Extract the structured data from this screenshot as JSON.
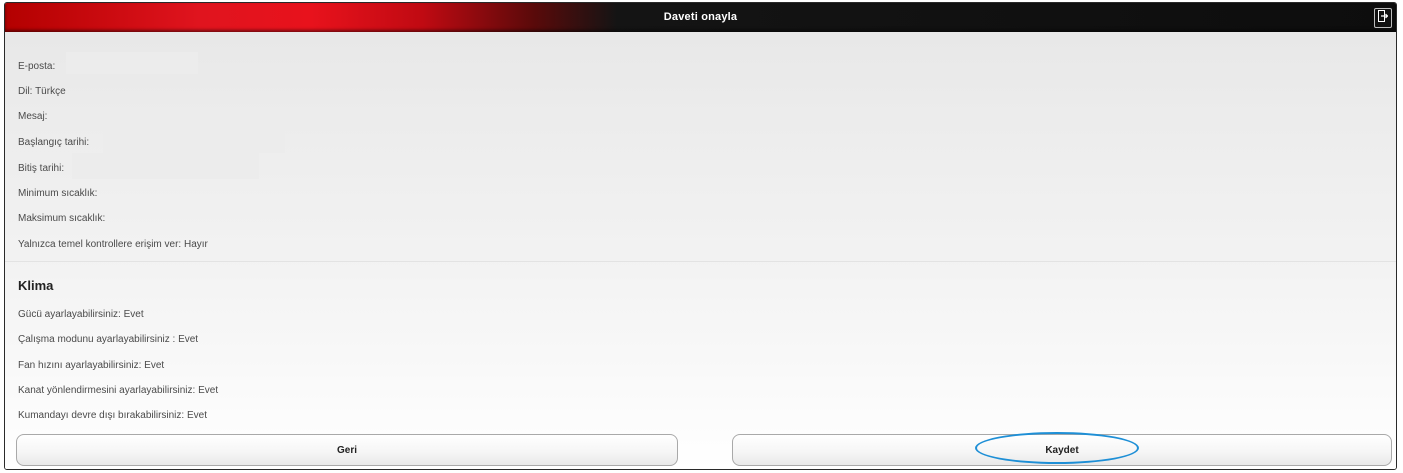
{
  "header": {
    "title": "Daveti onayla",
    "exit_icon": "exit-icon"
  },
  "fields": [
    {
      "label": "E-posta:",
      "value": ""
    },
    {
      "label": "Dil:",
      "value": "Türkçe"
    },
    {
      "label": "Mesaj:",
      "value": ""
    },
    {
      "label": "Başlangıç tarihi:",
      "value": ""
    },
    {
      "label": "Bitiş tarihi:",
      "value": ""
    },
    {
      "label": "Minimum sıcaklık:",
      "value": ""
    },
    {
      "label": "Maksimum sıcaklık:",
      "value": ""
    },
    {
      "label": "Yalnızca temel kontrollere erişim ver:",
      "value": "Hayır"
    }
  ],
  "section": {
    "title": "Klima",
    "items": [
      {
        "label": "Gücü ayarlayabilirsiniz:",
        "value": "Evet"
      },
      {
        "label": "Çalışma modunu ayarlayabilirsiniz :",
        "value": "Evet"
      },
      {
        "label": "Fan hızını ayarlayabilirsiniz:",
        "value": "Evet"
      },
      {
        "label": "Kanat yönlendirmesini ayarlayabilirsiniz:",
        "value": "Evet"
      },
      {
        "label": "Kumandayı devre dışı bırakabilirsiniz:",
        "value": "Evet"
      }
    ]
  },
  "buttons": {
    "back": "Geri",
    "save": "Kaydet"
  },
  "colors": {
    "header_red": "#e8121c",
    "header_dark": "#0d0d0d",
    "highlight": "#1e8fd6"
  }
}
